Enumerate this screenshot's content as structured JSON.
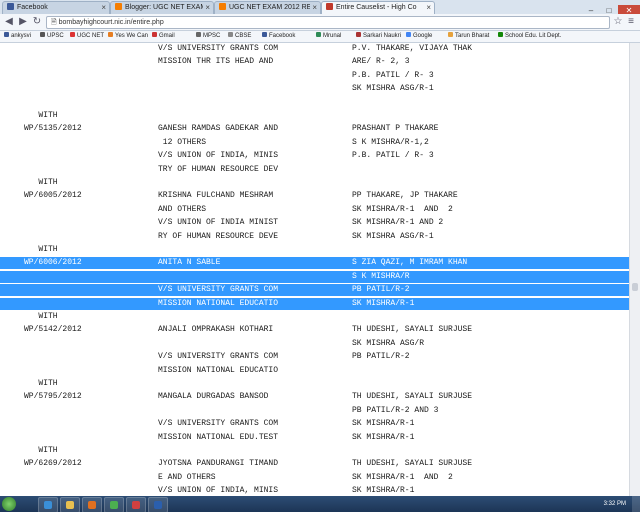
{
  "browser": {
    "tabs": [
      {
        "label": "Facebook",
        "color": "#3b5998"
      },
      {
        "label": "Blogger: UGC NET EXAM",
        "color": "#f57d00"
      },
      {
        "label": "UGC NET EXAM 2012 RES",
        "color": "#f57d00"
      },
      {
        "label": "Entire Causelist - High Co",
        "color": "#c0392b"
      }
    ],
    "url": "bombayhighcourt.nic.in/entire.php",
    "bookmarks": [
      {
        "label": "ankysvi",
        "color": "#3b5998"
      },
      {
        "label": "UPSC",
        "color": "#555555"
      },
      {
        "label": "UGC NET",
        "color": "#d33"
      },
      {
        "label": "Yes We Can",
        "color": "#e67e22"
      },
      {
        "label": "Gmail",
        "color": "#cc3333"
      },
      {
        "label": "MPSC",
        "color": "#666666"
      },
      {
        "label": "CBSE",
        "color": "#888888"
      },
      {
        "label": "Facebook",
        "color": "#3b5998"
      },
      {
        "label": "Mrunal",
        "color": "#2e8b57"
      },
      {
        "label": "Sarkari Naukri",
        "color": "#aa3333"
      },
      {
        "label": "Google",
        "color": "#4285f4"
      },
      {
        "label": "Tarun Bharat",
        "color": "#e6a23c"
      },
      {
        "label": "School Edu. Lit Dept.",
        "color": "#138808"
      }
    ]
  },
  "causelist": [
    {
      "c1": "",
      "c2": "V/S UNIVERSITY GRANTS COM",
      "c3": "P.V. THAKARE, VIJAYA THAK"
    },
    {
      "c1": "",
      "c2": "MISSION THR ITS HEAD AND",
      "c3": "ARE/ R- 2, 3"
    },
    {
      "c1": "",
      "c2": "",
      "c3": "P.B. PATIL / R- 3"
    },
    {
      "c1": "",
      "c2": "",
      "c3": "SK MISHRA ASG/R-1"
    },
    {
      "c1": "",
      "c2": "",
      "c3": ""
    },
    {
      "c1": "        WITH",
      "c2": "",
      "c3": ""
    },
    {
      "c1": "     WP/5135/2012",
      "c2": "GANESH RAMDAS GADEKAR AND",
      "c3": "PRASHANT P THAKARE"
    },
    {
      "c1": "",
      "c2": " 12 OTHERS",
      "c3": "S K MISHRA/R-1,2"
    },
    {
      "c1": "",
      "c2": "V/S UNION OF INDIA, MINIS",
      "c3": "P.B. PATIL / R- 3"
    },
    {
      "c1": "",
      "c2": "TRY OF HUMAN RESOURCE DEV",
      "c3": ""
    },
    {
      "c1": "        WITH",
      "c2": "",
      "c3": ""
    },
    {
      "c1": "     WP/6005/2012",
      "c2": "KRISHNA FULCHAND MESHRAM",
      "c3": "PP THAKARE, JP THAKARE"
    },
    {
      "c1": "",
      "c2": "AND OTHERS",
      "c3": "SK MISHRA/R-1  AND  2"
    },
    {
      "c1": "",
      "c2": "V/S UNION OF INDIA MINIST",
      "c3": "SK MISHRA/R-1 AND 2"
    },
    {
      "c1": "",
      "c2": "RY OF HUMAN RESOURCE DEVE",
      "c3": "SK MISHRA ASG/R-1"
    },
    {
      "c1": "        WITH",
      "c2": "",
      "c3": ""
    },
    {
      "c1": "     WP/6006/2012",
      "c2": "ANITA N SABLE",
      "c3": "S ZIA QAZI, M IMRAM KHAN",
      "hl": true
    },
    {
      "c1": "",
      "c2": "",
      "c3": "S K MISHRA/R",
      "hl": true
    },
    {
      "c1": "",
      "c2": "V/S UNIVERSITY GRANTS COM",
      "c3": "PB PATIL/R-2",
      "hl": true
    },
    {
      "c1": "",
      "c2": "MISSION NATIONAL EDUCATIO",
      "c3": "SK MISHRA/R-1",
      "hl": true
    },
    {
      "c1": "        WITH",
      "c2": "",
      "c3": ""
    },
    {
      "c1": "     WP/5142/2012",
      "c2": "ANJALI OMPRAKASH KOTHARI",
      "c3": "TH UDESHI, SAYALI SURJUSE"
    },
    {
      "c1": "",
      "c2": "",
      "c3": "SK MISHRA ASG/R"
    },
    {
      "c1": "",
      "c2": "V/S UNIVERSITY GRANTS COM",
      "c3": "PB PATIL/R-2"
    },
    {
      "c1": "",
      "c2": "MISSION NATIONAL EDUCATIO",
      "c3": ""
    },
    {
      "c1": "        WITH",
      "c2": "",
      "c3": ""
    },
    {
      "c1": "     WP/5795/2012",
      "c2": "MANGALA DURGADAS BANSOD",
      "c3": "TH UDESHI, SAYALI SURJUSE"
    },
    {
      "c1": "",
      "c2": "",
      "c3": "PB PATIL/R-2 AND 3"
    },
    {
      "c1": "",
      "c2": "V/S UNIVERSITY GRANTS COM",
      "c3": "SK MISHRA/R-1"
    },
    {
      "c1": "",
      "c2": "MISSION NATIONAL EDU.TEST",
      "c3": "SK MISHRA/R-1"
    },
    {
      "c1": "        WITH",
      "c2": "",
      "c3": ""
    },
    {
      "c1": "     WP/6269/2012",
      "c2": "JYOTSNA PANDURANGI TIMAND",
      "c3": "TH UDESHI, SAYALI SURJUSE"
    },
    {
      "c1": "",
      "c2": "E AND OTHERS",
      "c3": "SK MISHRA/R-1  AND  2"
    },
    {
      "c1": "",
      "c2": "V/S UNION OF INDIA, MINIS",
      "c3": "SK MISHRA/R-1"
    }
  ],
  "taskbar": {
    "apps": [
      {
        "name": "ie",
        "color": "#3a8fd8"
      },
      {
        "name": "explorer",
        "color": "#e8c050"
      },
      {
        "name": "media",
        "color": "#e07020"
      },
      {
        "name": "chrome",
        "color": "#4caf50"
      },
      {
        "name": "paint",
        "color": "#d04040"
      },
      {
        "name": "word",
        "color": "#2b5fad"
      }
    ],
    "clock": "3:32 PM"
  }
}
